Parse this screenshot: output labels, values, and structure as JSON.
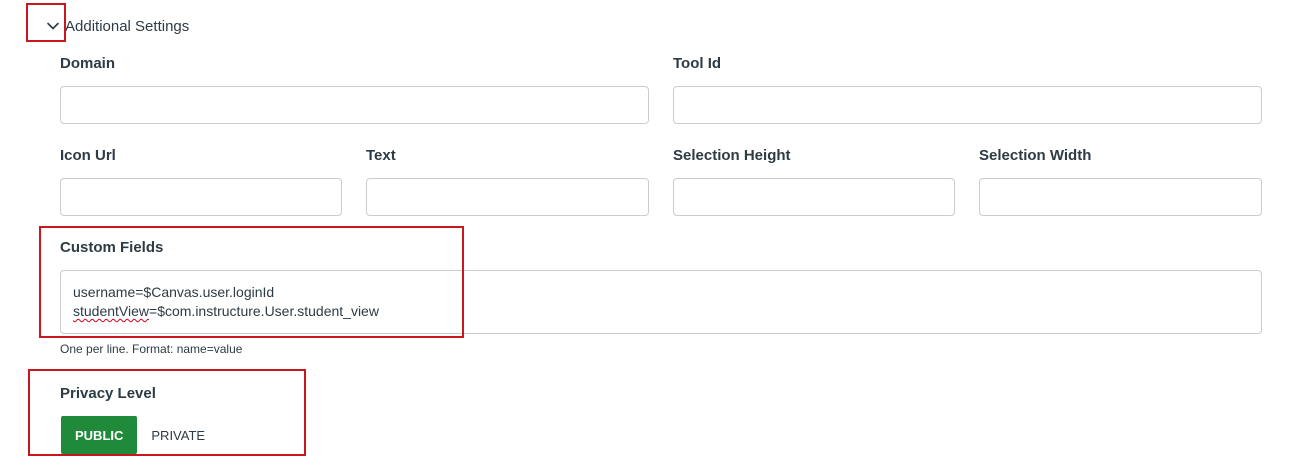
{
  "section": {
    "toggle_label": "Additional Settings",
    "expanded": true
  },
  "fields": {
    "domain": {
      "label": "Domain",
      "value": ""
    },
    "tool_id": {
      "label": "Tool Id",
      "value": ""
    },
    "icon_url": {
      "label": "Icon Url",
      "value": ""
    },
    "text": {
      "label": "Text",
      "value": ""
    },
    "selection_height": {
      "label": "Selection Height",
      "value": ""
    },
    "selection_width": {
      "label": "Selection Width",
      "value": ""
    }
  },
  "custom_fields": {
    "label": "Custom Fields",
    "line1": "username=$Canvas.user.loginId",
    "line2_key": "studentView",
    "line2_rest": "=$com.instructure.User.student_view",
    "hint": "One per line. Format: name=value"
  },
  "privacy": {
    "label": "Privacy Level",
    "options": [
      "PUBLIC",
      "PRIVATE"
    ],
    "selected": "PUBLIC",
    "accent": "#1e8a3a"
  },
  "highlight_color": "#c8171e"
}
